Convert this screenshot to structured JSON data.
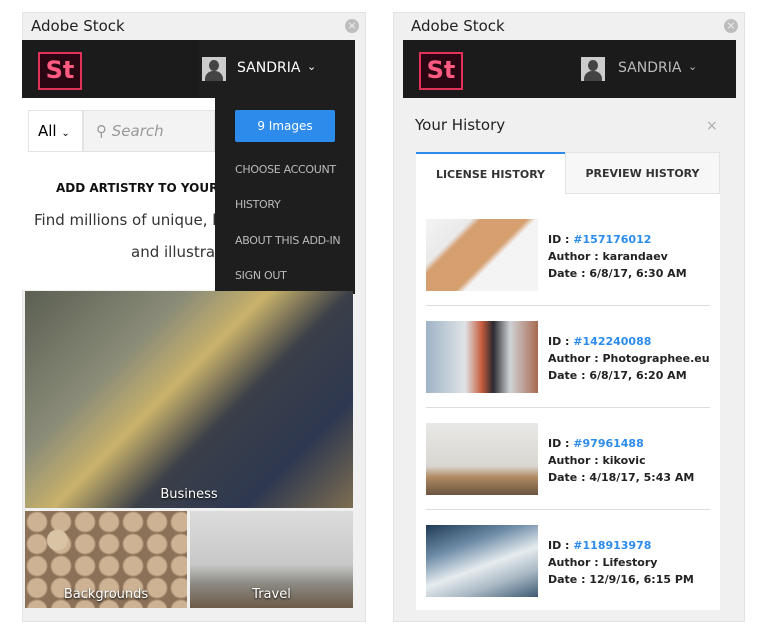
{
  "left_panel": {
    "title": "Adobe Stock",
    "logo": "St",
    "user": "SANDRIA",
    "search": {
      "filter": "All",
      "placeholder": "Search"
    },
    "headline": "ADD ARTISTRY TO YOUR",
    "tagline_1": "Find millions of unique, hi",
    "tagline_2": "and illustrat",
    "menu": {
      "images_button": "9 Images",
      "items": [
        "CHOOSE ACCOUNT",
        "HISTORY",
        "ABOUT THIS ADD-IN",
        "SIGN OUT"
      ]
    },
    "categories": [
      "Business",
      "Backgrounds",
      "Travel"
    ]
  },
  "right_panel": {
    "title": "Adobe Stock",
    "logo": "St",
    "user": "SANDRIA",
    "heading": "Your History",
    "tabs": [
      {
        "label": "LICENSE HISTORY",
        "active": true
      },
      {
        "label": "PREVIEW HISTORY",
        "active": false
      }
    ],
    "accent": "#2d8ceb",
    "items": [
      {
        "id_label": "ID : ",
        "id": "#157176012",
        "author": "Author : karandaev",
        "date": "Date : 6/8/17, 6:30 AM"
      },
      {
        "id_label": "ID : ",
        "id": "#142240088",
        "author": "Author : Photographee.eu",
        "date": "Date : 6/8/17, 6:20 AM"
      },
      {
        "id_label": "ID : ",
        "id": "#97961488",
        "author": "Author : kikovic",
        "date": "Date : 4/18/17, 5:43 AM"
      },
      {
        "id_label": "ID : ",
        "id": "#118913978",
        "author": "Author : Lifestory",
        "date": "Date : 12/9/16, 6:15 PM"
      }
    ]
  }
}
